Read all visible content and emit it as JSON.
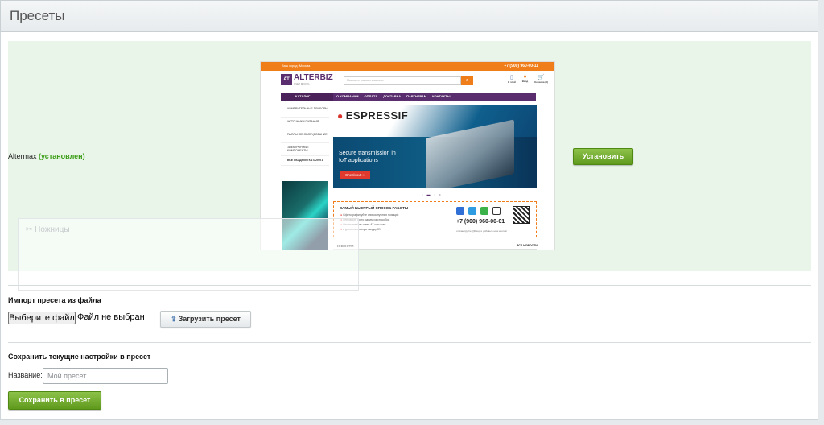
{
  "page": {
    "title": "Пресеты"
  },
  "preset": {
    "name": "Altermax",
    "status": "(установлен)",
    "install_label": "Установить"
  },
  "preview": {
    "region_text": "Ваш город: Москва",
    "phone_top": "+7 (900) 960-00-11",
    "logo_mark": "AT",
    "logo_text": "ALTERBIZ",
    "logo_sub": "СЧЕТ МОСТЬ",
    "search_placeholder": "Поиск по наименованию",
    "header_icons": [
      {
        "icon": "compare-icon",
        "label": "В этой"
      },
      {
        "icon": "user-icon",
        "label": "Вход"
      },
      {
        "icon": "cart-icon",
        "label": "Корзина (0)"
      }
    ],
    "nav_catalog": "КАТАЛОГ",
    "nav_links": [
      "О КОМПАНИИ",
      "ОПЛАТА",
      "ДОСТАВКА",
      "ПАРТНЕРАМ",
      "КОНТАКТЫ"
    ],
    "sidebar": [
      "ИЗМЕРИТЕЛЬНЫЕ ПРИБОРЫ",
      "ИСТОЧНИКИ ПИТАНИЯ",
      "ПАЯЛЬНОЕ ОБОРУДОВАНИЕ",
      "ЭЛЕКТРОННЫЕ КОМПОНЕНТЫ"
    ],
    "sidebar_all": "ВСЕ РАЗДЕЛЫ КАТАЛОГА",
    "banner_brand": "ESPRESSIF",
    "banner_text": "Secure transmission in IoT applications",
    "banner_cta": "Check out »",
    "info_heading": "САМЫЙ БЫСТРЫЙ СПОСОБ РАБОТЫ",
    "info_items": [
      "Сфотографируйте список нужных позиций",
      "Отправьте фото одним из способов",
      "Отслеживайте ответ АТ или счет",
      "и дополнительную скидку 3%"
    ],
    "info_phone": "+7 (900) 960-00-01",
    "info_sub": "отсканируйте QR-код и добавьте наш контакт",
    "news_label": "НОВОСТИ",
    "news_all": "ВСЕ НОВОСТИ"
  },
  "ghost": {
    "label": "Ножницы"
  },
  "import": {
    "title": "Импорт пресета из файла",
    "choose_label": "Выберите файл",
    "no_file": "Файл не выбран",
    "upload_label": "Загрузить пресет"
  },
  "save": {
    "title": "Сохранить текущие настройки в пресет",
    "name_label": "Название:",
    "name_placeholder": "Мой пресет",
    "save_label": "Сохранить в пресет"
  },
  "colors": {
    "accent_green": "#5f9a1d",
    "installed_green": "#3a9d16",
    "preview_orange": "#ef7d1a",
    "preview_purple": "#5a2d6e"
  }
}
